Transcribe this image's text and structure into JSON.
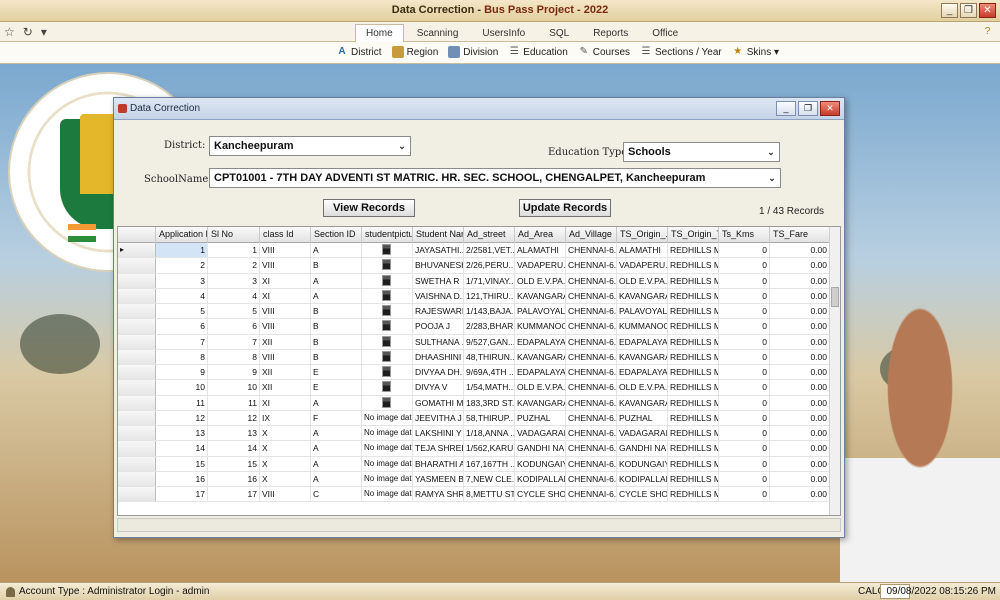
{
  "app": {
    "title_prefix": "Data Correction - ",
    "title_brand": "Bus Pass Project - 2022",
    "win_minimize": "_",
    "win_restore": "❐",
    "win_close": "✕"
  },
  "ribbon": {
    "tabs": [
      "Home",
      "Scanning",
      "UsersInfo",
      "SQL",
      "Reports",
      "Office"
    ],
    "active_tab": "Home",
    "commands": [
      {
        "label": "District",
        "icon": "district-icon"
      },
      {
        "label": "Region",
        "icon": "region-icon"
      },
      {
        "label": "Division",
        "icon": "division-icon"
      },
      {
        "label": "Education",
        "icon": "education-icon"
      },
      {
        "label": "Courses",
        "icon": "courses-icon"
      },
      {
        "label": "Sections / Year",
        "icon": "sections-icon"
      },
      {
        "label": "Skins ▾",
        "icon": "skins-icon"
      }
    ]
  },
  "form": {
    "title": "Data Correction",
    "district_label": "District:",
    "district_value": "Kancheepuram",
    "education_type_label": "Education Type :",
    "education_type_value": "Schools",
    "school_label": "SchoolName:",
    "school_value": "CPT01001 - 7TH DAY ADVENTI ST MATRIC. HR. SEC. SCHOOL, CHENGALPET, Kancheepuram",
    "view_button": "View  Records",
    "update_button": "Update Records",
    "records_info": "1 / 43 Records"
  },
  "grid": {
    "columns": [
      "Application ID",
      "Sl No",
      "class Id",
      "Section ID",
      "studentpicture",
      "Student Name",
      "Ad_street",
      "Ad_Area",
      "Ad_Village",
      "TS_Origin_...",
      "TS_Origin_To",
      "Ts_Kms",
      "TS_Fare"
    ],
    "no_image_text": "No image data",
    "rows": [
      {
        "app_id": "1",
        "sl": "1",
        "cls": "VIII",
        "sec": "A",
        "pic": true,
        "name": "JAYASATHI...",
        "street": "2/2581,VET...",
        "area": "ALAMATHI",
        "village": "CHENNAI-6...",
        "origin": "ALAMATHI",
        "to": "REDHILLS M...",
        "kms": "0",
        "fare": "0.00"
      },
      {
        "app_id": "2",
        "sl": "2",
        "cls": "VIII",
        "sec": "B",
        "pic": true,
        "name": "BHUVANESH...",
        "street": "2/26,PERU...",
        "area": "VADAPERU...",
        "village": "CHENNAI-6...",
        "origin": "VADAPERU...",
        "to": "REDHILLS M...",
        "kms": "0",
        "fare": "0.00"
      },
      {
        "app_id": "3",
        "sl": "3",
        "cls": "XI",
        "sec": "A",
        "pic": true,
        "name": "SWETHA R",
        "street": "1/71,VINAY...",
        "area": "OLD E.V.PA...",
        "village": "CHENNAI-6...",
        "origin": "OLD E.V.PA...",
        "to": "REDHILLS M...",
        "kms": "0",
        "fare": "0.00"
      },
      {
        "app_id": "4",
        "sl": "4",
        "cls": "XI",
        "sec": "A",
        "pic": true,
        "name": "VAISHNA D...",
        "street": "121,THIRU...",
        "area": "KAVANGARAI",
        "village": "CHENNAI-6...",
        "origin": "KAVANGARAI",
        "to": "REDHILLS M...",
        "kms": "0",
        "fare": "0.00"
      },
      {
        "app_id": "5",
        "sl": "5",
        "cls": "VIII",
        "sec": "B",
        "pic": true,
        "name": "RAJESWARI J",
        "street": "1/143,BAJA...",
        "area": "PALAVOYAL",
        "village": "CHENNAI-6...",
        "origin": "PALAVOYAL",
        "to": "REDHILLS M...",
        "kms": "0",
        "fare": "0.00"
      },
      {
        "app_id": "6",
        "sl": "6",
        "cls": "VIII",
        "sec": "B",
        "pic": true,
        "name": "POOJA J",
        "street": "2/283,BHAR...",
        "area": "KUMMANOOR",
        "village": "CHENNAI-6...",
        "origin": "KUMMANOOR",
        "to": "REDHILLS M...",
        "kms": "0",
        "fare": "0.00"
      },
      {
        "app_id": "7",
        "sl": "7",
        "cls": "XII",
        "sec": "B",
        "pic": true,
        "name": "SULTHANA ...",
        "street": "9/527,GAN...",
        "area": "EDAPALAYAM",
        "village": "CHENNAI-6...",
        "origin": "EDAPALAYAM",
        "to": "REDHILLS M...",
        "kms": "0",
        "fare": "0.00"
      },
      {
        "app_id": "8",
        "sl": "8",
        "cls": "VIII",
        "sec": "B",
        "pic": true,
        "name": "DHAASHINI A",
        "street": "48,THIRUN...",
        "area": "KAVANGARAI",
        "village": "CHENNAI-6...",
        "origin": "KAVANGARAI",
        "to": "REDHILLS M...",
        "kms": "0",
        "fare": "0.00"
      },
      {
        "app_id": "9",
        "sl": "9",
        "cls": "XII",
        "sec": "E",
        "pic": true,
        "name": "DIVYAA DH...",
        "street": "9/69A,4TH ...",
        "area": "EDAPALAYAM",
        "village": "CHENNAI-6...",
        "origin": "EDAPALAYAM",
        "to": "REDHILLS M...",
        "kms": "0",
        "fare": "0.00"
      },
      {
        "app_id": "10",
        "sl": "10",
        "cls": "XII",
        "sec": "E",
        "pic": true,
        "name": "DIVYA V",
        "street": "1/54,MATH...",
        "area": "OLD E.V.PA...",
        "village": "CHENNAI-6...",
        "origin": "OLD E.V.PA...",
        "to": "REDHILLS M...",
        "kms": "0",
        "fare": "0.00"
      },
      {
        "app_id": "11",
        "sl": "11",
        "cls": "XI",
        "sec": "A",
        "pic": true,
        "name": "GOMATHI M",
        "street": "183,3RD ST...",
        "area": "KAVANGARAI",
        "village": "CHENNAI-6...",
        "origin": "KAVANGARAI",
        "to": "REDHILLS M...",
        "kms": "0",
        "fare": "0.00"
      },
      {
        "app_id": "12",
        "sl": "12",
        "cls": "IX",
        "sec": "F",
        "pic": false,
        "name": "JEEVITHA J",
        "street": "58,THIRUP...",
        "area": "PUZHAL",
        "village": "CHENNAI-6...",
        "origin": "PUZHAL",
        "to": "REDHILLS M...",
        "kms": "0",
        "fare": "0.00"
      },
      {
        "app_id": "13",
        "sl": "13",
        "cls": "X",
        "sec": "A",
        "pic": false,
        "name": "LAKSHINI Y",
        "street": "1/18,ANNA ...",
        "area": "VADAGARAI",
        "village": "CHENNAI-6...",
        "origin": "VADAGARAI",
        "to": "REDHILLS M...",
        "kms": "0",
        "fare": "0.00"
      },
      {
        "app_id": "14",
        "sl": "14",
        "cls": "X",
        "sec": "A",
        "pic": false,
        "name": "TEJA SHREE S",
        "street": "1/562,KARU...",
        "area": "GANDHI NA...",
        "village": "CHENNAI-6...",
        "origin": "GANDHI NA...",
        "to": "REDHILLS M...",
        "kms": "0",
        "fare": "0.00"
      },
      {
        "app_id": "15",
        "sl": "15",
        "cls": "X",
        "sec": "A",
        "pic": false,
        "name": "BHARATHI A",
        "street": "167,167TH ...",
        "area": "KODUNGAIY...",
        "village": "CHENNAI-6...",
        "origin": "KODUNGAIY...",
        "to": "REDHILLS M...",
        "kms": "0",
        "fare": "0.00"
      },
      {
        "app_id": "16",
        "sl": "16",
        "cls": "X",
        "sec": "A",
        "pic": false,
        "name": "YASMEEN B",
        "street": "7,NEW CLE...",
        "area": "KODIPALLAM",
        "village": "CHENNAI-6...",
        "origin": "KODIPALLAM",
        "to": "REDHILLS M...",
        "kms": "0",
        "fare": "0.00"
      },
      {
        "app_id": "17",
        "sl": "17",
        "cls": "VIII",
        "sec": "C",
        "pic": false,
        "name": "RAMYA SHR...",
        "street": "8,METTU ST,",
        "area": "CYCLE SHOP",
        "village": "CHENNAI-6...",
        "origin": "CYCLE SHOP",
        "to": "REDHILLS M...",
        "kms": "0",
        "fare": "0.00"
      }
    ]
  },
  "status": {
    "account": "Account Type : Administrator Login - admin",
    "calc": "CALC",
    "datetime": "09/08/2022 08:15:26 PM"
  },
  "colors": {
    "selection": "#d3e4f7",
    "title_brand": "#7a2a0f"
  }
}
